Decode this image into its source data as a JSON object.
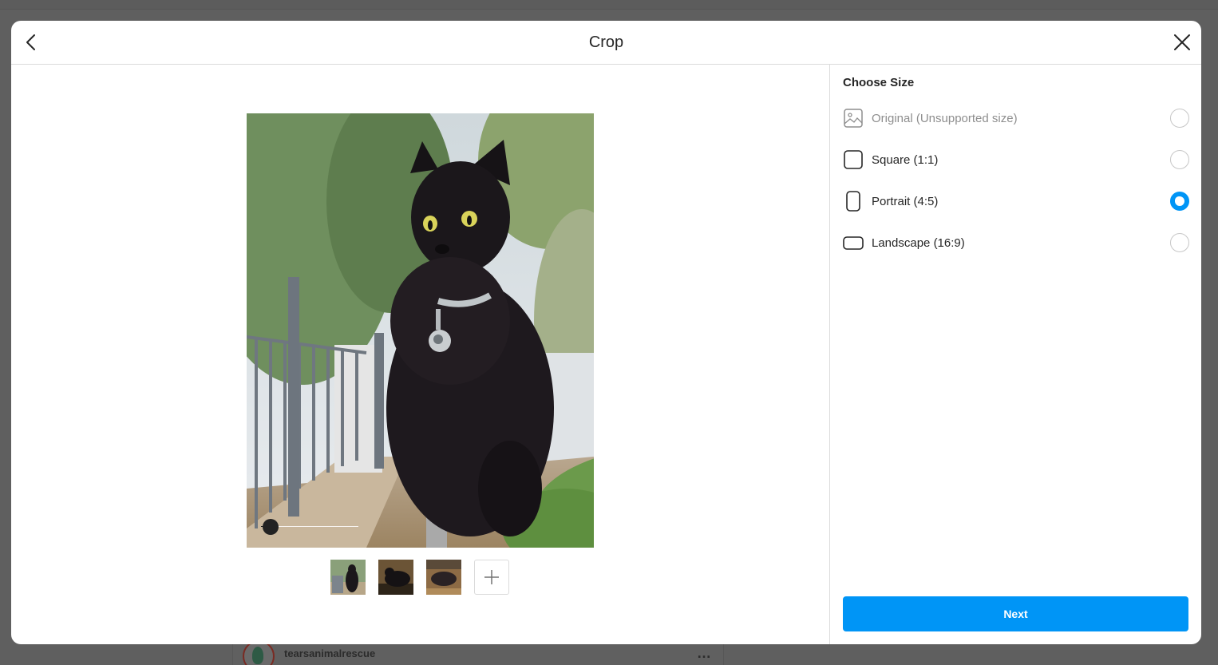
{
  "background": {
    "username": "tearsanimalrescue",
    "more_icon": "…"
  },
  "modal": {
    "title": "Crop",
    "back_icon": "chevron-left-icon",
    "close_icon": "close-icon"
  },
  "editor": {
    "zoom_level": 0.1,
    "thumbnail_count": 3,
    "add_icon": "plus-icon"
  },
  "crop_panel": {
    "title": "Choose Size",
    "options": [
      {
        "label": "Original (Unsupported size)",
        "icon": "image-icon",
        "disabled": true,
        "selected": false
      },
      {
        "label": "Square (1:1)",
        "icon": "square-crop-icon",
        "disabled": false,
        "selected": false
      },
      {
        "label": "Portrait (4:5)",
        "icon": "portrait-crop-icon",
        "disabled": false,
        "selected": true
      },
      {
        "label": "Landscape (16:9)",
        "icon": "landscape-crop-icon",
        "disabled": false,
        "selected": false
      }
    ],
    "next_label": "Next"
  },
  "colors": {
    "accent": "#0095f6",
    "border": "#dbdbdb",
    "text": "#262626",
    "muted": "#8e8e8e"
  }
}
